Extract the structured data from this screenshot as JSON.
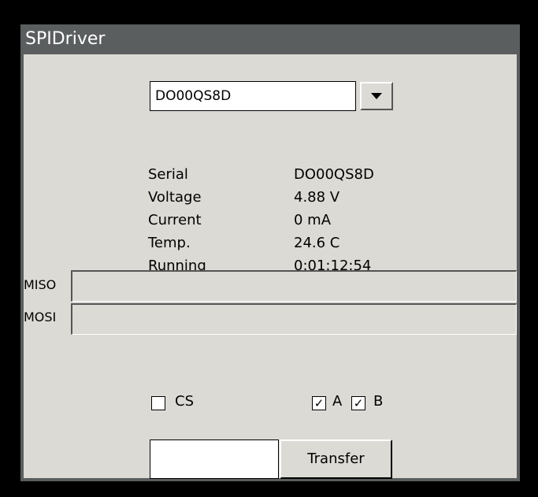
{
  "window": {
    "title": "SPIDriver"
  },
  "device_select": {
    "value": "DO00QS8D",
    "dropdown_icon": "triangle-down-icon"
  },
  "info": {
    "serial_label": "Serial",
    "serial_value": "DO00QS8D",
    "voltage_label": "Voltage",
    "voltage_value": "4.88 V",
    "current_label": "Current",
    "current_value": "0 mA",
    "temp_label": "Temp.",
    "temp_value": "24.6 C",
    "running_label": "Running",
    "running_value": "0:01:12:54"
  },
  "io": {
    "miso_label": "MISO",
    "mosi_label": "MOSI",
    "miso_value": "",
    "mosi_value": ""
  },
  "toggles": {
    "cs_label": "CS",
    "cs_checked": false,
    "a_label": "A",
    "a_checked": true,
    "b_label": "B",
    "b_checked": true,
    "check_mark": "✓"
  },
  "transfer": {
    "input_value": "",
    "button_label": "Transfer"
  },
  "colors": {
    "window_bg": "#dcdad5",
    "titlebar_bg": "#5b5e5f",
    "title_text": "#ffffff"
  }
}
